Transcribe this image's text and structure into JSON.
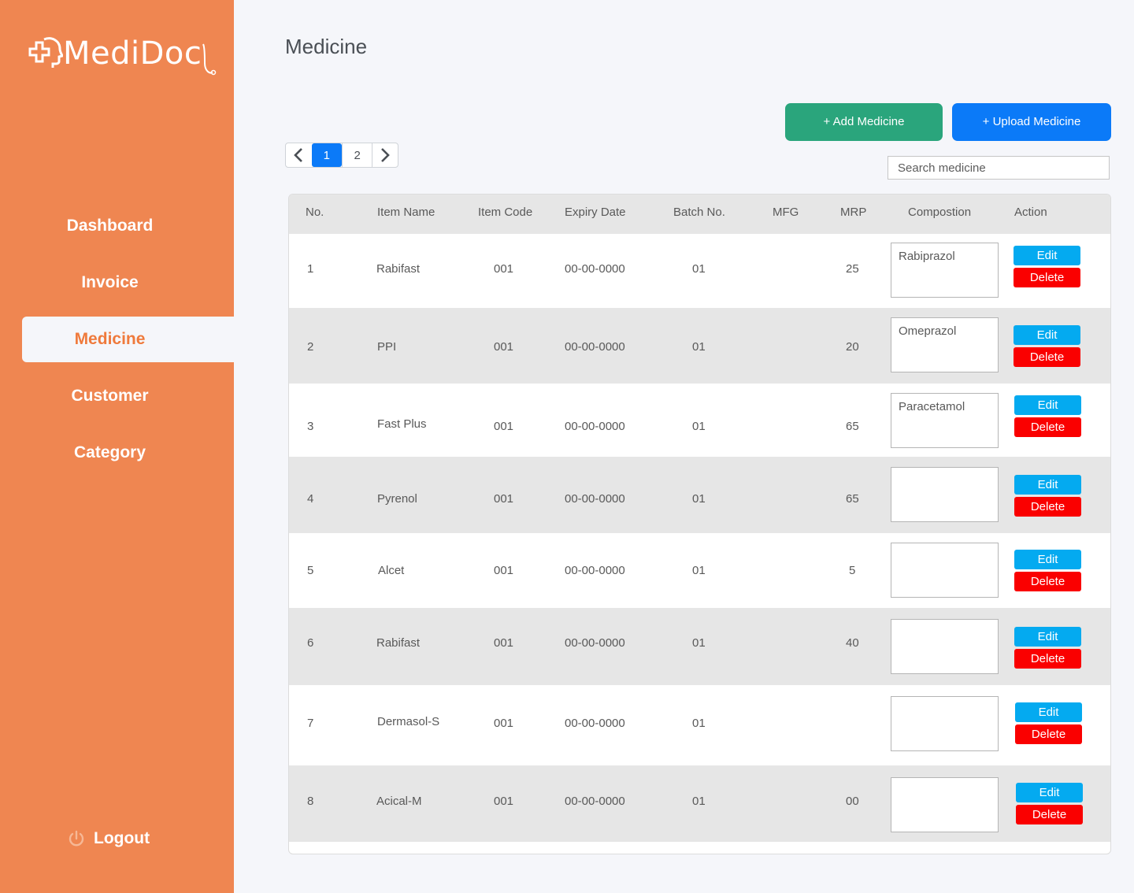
{
  "sidebar": {
    "logo_text": "MediDoc",
    "nav": [
      {
        "label": "Dashboard",
        "name": "nav-dashboard",
        "active": false
      },
      {
        "label": "Invoice",
        "name": "nav-invoice",
        "active": false
      },
      {
        "label": "Medicine",
        "name": "nav-medicine",
        "active": true
      },
      {
        "label": "Customer",
        "name": "nav-customer",
        "active": false
      },
      {
        "label": "Category",
        "name": "nav-category",
        "active": false
      }
    ],
    "logout_label": "Logout",
    "logout_icon": "power-icon"
  },
  "main": {
    "title": "Medicine",
    "add_button": "+ Add Medicine",
    "upload_button": "+ Upload Medicine",
    "search_placeholder": "Search medicine",
    "pagination": {
      "pages": [
        "1",
        "2"
      ],
      "current": "1"
    }
  },
  "table": {
    "headers": [
      "No.",
      "Item Name",
      "Item Code",
      "Expiry Date",
      "Batch No.",
      "MFG",
      "MRP",
      "Compostion",
      "Action"
    ],
    "edit_label": "Edit",
    "delete_label": "Delete",
    "rows": [
      {
        "no": "1",
        "name": "Rabifast",
        "code": "001",
        "expiry": "00-00-0000",
        "batch": "01",
        "mfg": "",
        "mrp": "25",
        "composition": "Rabiprazol"
      },
      {
        "no": "2",
        "name": "PPI",
        "code": "001",
        "expiry": "00-00-0000",
        "batch": "01",
        "mfg": "",
        "mrp": "20",
        "composition": "Omeprazol"
      },
      {
        "no": "3",
        "name": "Fast Plus",
        "code": "001",
        "expiry": "00-00-0000",
        "batch": "01",
        "mfg": "",
        "mrp": "65",
        "composition": "Paracetamol"
      },
      {
        "no": "4",
        "name": "Pyrenol",
        "code": "001",
        "expiry": "00-00-0000",
        "batch": "01",
        "mfg": "",
        "mrp": "65",
        "composition": ""
      },
      {
        "no": "5",
        "name": "Alcet",
        "code": "001",
        "expiry": "00-00-0000",
        "batch": "01",
        "mfg": "",
        "mrp": "5",
        "composition": ""
      },
      {
        "no": "6",
        "name": "Rabifast",
        "code": "001",
        "expiry": "00-00-0000",
        "batch": "01",
        "mfg": "",
        "mrp": "40",
        "composition": ""
      },
      {
        "no": "7",
        "name": "Dermasol-S",
        "code": "001",
        "expiry": "00-00-0000",
        "batch": "01",
        "mfg": "",
        "mrp": "",
        "composition": ""
      },
      {
        "no": "8",
        "name": "Acical-M",
        "code": "001",
        "expiry": "00-00-0000",
        "batch": "01",
        "mfg": "",
        "mrp": "00",
        "composition": ""
      }
    ]
  },
  "colors": {
    "sidebar": "#ef8651",
    "page_bg": "#f5f6fa",
    "add_button": "#2aa57c",
    "upload_button": "#0b7af8",
    "edit_button": "#04aaf0",
    "delete_button": "#fa0000",
    "row_alt": "#e6e6e6"
  }
}
